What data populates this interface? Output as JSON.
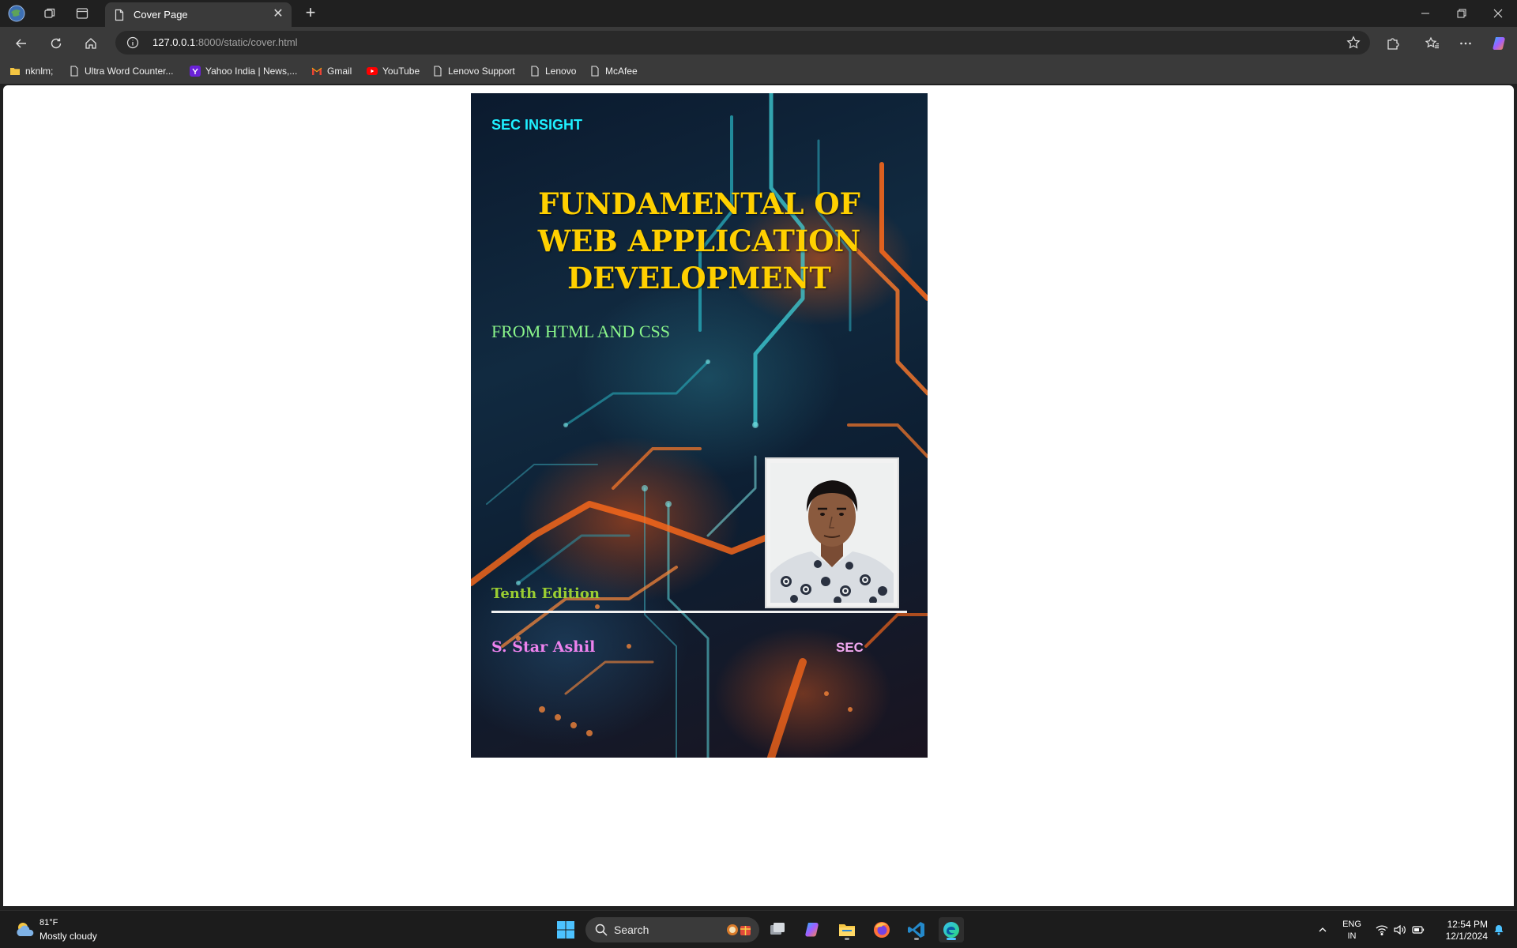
{
  "browser": {
    "tab": {
      "title": "Cover Page"
    },
    "address": {
      "host": "127.0.0.1",
      "path": ":8000/static/cover.html"
    },
    "bookmarks": [
      {
        "label": "nknlm;",
        "icon": "folder-icon"
      },
      {
        "label": "Ultra Word Counter...",
        "icon": "page-icon"
      },
      {
        "label": "Yahoo India | News,...",
        "icon": "yahoo-icon"
      },
      {
        "label": "Gmail",
        "icon": "gmail-icon"
      },
      {
        "label": "YouTube",
        "icon": "youtube-icon"
      },
      {
        "label": "Lenovo Support",
        "icon": "page-icon"
      },
      {
        "label": "Lenovo",
        "icon": "page-icon"
      },
      {
        "label": "McAfee",
        "icon": "page-icon"
      }
    ]
  },
  "cover": {
    "publisher": "SEC INSIGHT",
    "title_lines": [
      "FUNDAMENTAL OF",
      "WEB APPLICATION",
      "DEVELOPMENT"
    ],
    "subtitle": "FROM HTML AND CSS",
    "edition": "Tenth Edition",
    "author": "S. Star Ashil",
    "publisher_short": "SEC",
    "colors": {
      "publisher": "#1ff0ff",
      "title": "#ffd000",
      "subtitle": "#8af58a",
      "edition": "#9acd32",
      "author": "#ee82ee",
      "publisher_short": "#f0a8f0"
    }
  },
  "taskbar": {
    "weather": {
      "temp": "81°F",
      "desc": "Mostly cloudy"
    },
    "search_label": "Search",
    "lang": {
      "line1": "ENG",
      "line2": "IN"
    },
    "clock": {
      "time": "12:54 PM",
      "date": "12/1/2024"
    }
  }
}
